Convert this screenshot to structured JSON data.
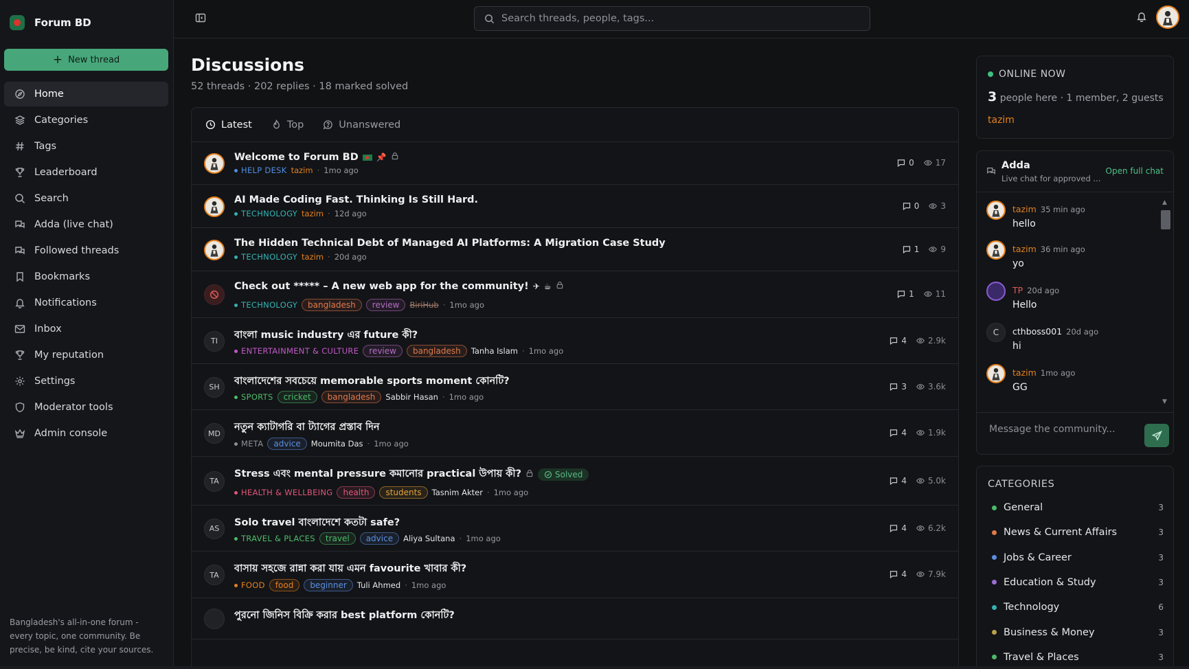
{
  "brand": {
    "name": "Forum BD"
  },
  "sidebar": {
    "new_thread": "New thread",
    "items": [
      {
        "label": "Home",
        "icon": "home-icon"
      },
      {
        "label": "Categories",
        "icon": "layers-icon"
      },
      {
        "label": "Tags",
        "icon": "hash-icon"
      },
      {
        "label": "Leaderboard",
        "icon": "trophy-icon"
      },
      {
        "label": "Search",
        "icon": "search-icon"
      },
      {
        "label": "Adda (live chat)",
        "icon": "chat-icon"
      },
      {
        "label": "Followed threads",
        "icon": "chat-icon"
      },
      {
        "label": "Bookmarks",
        "icon": "bookmark-icon"
      },
      {
        "label": "Notifications",
        "icon": "bell-icon"
      },
      {
        "label": "Inbox",
        "icon": "mail-icon"
      },
      {
        "label": "My reputation",
        "icon": "trophy-icon"
      },
      {
        "label": "Settings",
        "icon": "gear-icon"
      },
      {
        "label": "Moderator tools",
        "icon": "shield-icon"
      },
      {
        "label": "Admin console",
        "icon": "crown-icon"
      }
    ],
    "footer": "Bangladesh's all-in-one forum - every topic, one community. Be precise, be kind, cite your sources."
  },
  "search": {
    "placeholder": "Search threads, people, tags..."
  },
  "main": {
    "title": "Discussions",
    "subtitle": "52 threads · 202 replies · 18 marked solved",
    "tabs": [
      "Latest",
      "Top",
      "Unanswered"
    ]
  },
  "colors": {
    "accent": "#47a77a",
    "author": "#e4811f"
  },
  "threads": [
    {
      "title": "Welcome to Forum BD",
      "avatar": "tazim-avatar",
      "category": "HELP DESK",
      "cat_color": "#4f8fe0",
      "tags": [],
      "author": "tazim",
      "time": "1mo ago",
      "replies": "0",
      "views": "17"
    },
    {
      "title": "AI Made Coding Fast. Thinking Is Still Hard.",
      "avatar": "tazim-avatar",
      "category": "TECHNOLOGY",
      "cat_color": "#33b3b3",
      "tags": [],
      "author": "tazim",
      "time": "12d ago",
      "replies": "0",
      "views": "3"
    },
    {
      "title": "The Hidden Technical Debt of Managed AI Platforms: A Migration Case Study",
      "avatar": "tazim-avatar",
      "category": "TECHNOLOGY",
      "cat_color": "#33b3b3",
      "tags": [],
      "author": "tazim",
      "time": "20d ago",
      "replies": "1",
      "views": "9"
    },
    {
      "title": "Check out ***** – A new web app for the community!",
      "avatar": "banned-avatar",
      "category": "TECHNOLOGY",
      "cat_color": "#33b3b3",
      "tags": [
        "bangladesh",
        "review"
      ],
      "author": "BiriHub",
      "time": "1mo ago",
      "replies": "1",
      "views": "11"
    },
    {
      "title": "বাংলা music industry এর future কী?",
      "avatar": "TI",
      "category": "ENTERTAINMENT & CULTURE",
      "cat_color": "#c158c8",
      "tags": [
        "review",
        "bangladesh"
      ],
      "author": "Tanha Islam",
      "time": "1mo ago",
      "replies": "4",
      "views": "2.9k"
    },
    {
      "title": "বাংলাদেশের সবচেয়ে memorable sports moment কোনটি?",
      "avatar": "SH",
      "category": "SPORTS",
      "cat_color": "#4cbc6a",
      "tags": [
        "cricket",
        "bangladesh"
      ],
      "author": "Sabbir Hasan",
      "time": "1mo ago",
      "replies": "3",
      "views": "3.6k"
    },
    {
      "title": "নতুন ক্যাটাগরি বা ট্যাগের প্রস্তাব দিন",
      "avatar": "MD",
      "category": "META",
      "cat_color": "#8e9197",
      "tags": [
        "advice"
      ],
      "author": "Moumita Das",
      "time": "1mo ago",
      "replies": "4",
      "views": "1.9k"
    },
    {
      "title": "Stress এবং mental pressure কমানোর practical উপায় কী?",
      "avatar": "TA",
      "category": "HEALTH & WELLBEING",
      "cat_color": "#e0567a",
      "tags": [
        "health",
        "students"
      ],
      "author": "Tasnim Akter",
      "time": "1mo ago",
      "replies": "4",
      "views": "5.0k",
      "solved": "Solved"
    },
    {
      "title": "Solo travel বাংলাদেশে কতটা safe?",
      "avatar": "AS",
      "category": "TRAVEL & PLACES",
      "cat_color": "#4cbc6a",
      "tags": [
        "travel",
        "advice"
      ],
      "author": "Aliya Sultana",
      "time": "1mo ago",
      "replies": "4",
      "views": "6.2k"
    },
    {
      "title": "বাসায় সহজে রান্না করা যায় এমন favourite খাবার কী?",
      "avatar": "TA",
      "category": "FOOD",
      "cat_color": "#e4811f",
      "tags": [
        "food",
        "beginner"
      ],
      "author": "Tuli Ahmed",
      "time": "1mo ago",
      "replies": "4",
      "views": "7.9k"
    },
    {
      "title": "পুরনো জিনিস বিক্রি করার best platform কোনটি?",
      "avatar": "",
      "category": "",
      "cat_color": "#8e9197",
      "tags": [],
      "author": "",
      "time": "",
      "replies": "",
      "views": ""
    }
  ],
  "tag_colors": {
    "bangladesh": "#e07a4a",
    "review": "#b46cc4",
    "cricket": "#4cbc6a",
    "advice": "#5b8fe0",
    "health": "#e0567a",
    "students": "#e4a33a",
    "travel": "#4cbc6a",
    "food": "#e4811f",
    "beginner": "#5b8fe0"
  },
  "online": {
    "title": "ONLINE NOW",
    "count": "3",
    "detail": "people here · 1 member, 2 guests",
    "user": "tazim"
  },
  "chat": {
    "title": "Adda",
    "subtitle": "Live chat for approved ...",
    "open": "Open full chat",
    "placeholder": "Message the community...",
    "messages": [
      {
        "name": "tazim",
        "time": "35 min ago",
        "text": "hello"
      },
      {
        "name": "tazim",
        "time": "36 min ago",
        "text": "yo"
      },
      {
        "name": "TP",
        "time": "20d ago",
        "text": "Hello"
      },
      {
        "name": "cthboss001",
        "time": "20d ago",
        "text": "hi",
        "initial": "C"
      },
      {
        "name": "tazim",
        "time": "1mo ago",
        "text": "GG"
      }
    ]
  },
  "categories": {
    "title": "CATEGORIES",
    "items": [
      {
        "name": "General",
        "count": "3",
        "color": "#4cbc6a"
      },
      {
        "name": "News & Current Affairs",
        "count": "3",
        "color": "#e07a4a"
      },
      {
        "name": "Jobs & Career",
        "count": "3",
        "color": "#5b8fe0"
      },
      {
        "name": "Education & Study",
        "count": "3",
        "color": "#9b6cd6"
      },
      {
        "name": "Technology",
        "count": "6",
        "color": "#33b3b3"
      },
      {
        "name": "Business & Money",
        "count": "3",
        "color": "#b9a24a"
      },
      {
        "name": "Travel & Places",
        "count": "3",
        "color": "#4cbc6a"
      }
    ]
  }
}
